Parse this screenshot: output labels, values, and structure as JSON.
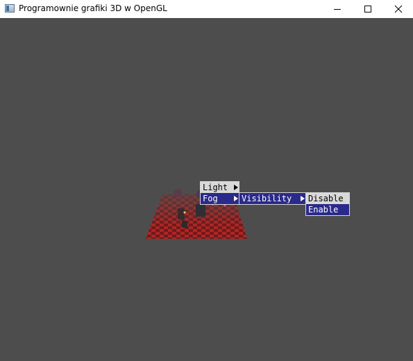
{
  "window": {
    "title": "Programownie grafiki 3D w OpenGL",
    "background_color": "#4d4d4d",
    "icons": {
      "app": "app-window-icon",
      "minimize": "minimize-icon",
      "maximize": "maximize-icon",
      "close": "close-icon"
    }
  },
  "context_menu": {
    "items": [
      {
        "label": "Light",
        "has_submenu": true,
        "highlighted": true
      },
      {
        "label": "Fog",
        "has_submenu": true,
        "highlighted": false
      }
    ],
    "fog_submenu": {
      "items": [
        {
          "label": "Visibility",
          "has_submenu": true,
          "highlighted": false
        }
      ]
    },
    "visibility_submenu": {
      "items": [
        {
          "label": "Disable",
          "highlighted": true
        },
        {
          "label": "Enable",
          "highlighted": false
        }
      ]
    },
    "colors": {
      "menu_bg": "#2a2a8a",
      "highlight_bg": "#d9d9d9",
      "text": "#ffffff"
    }
  }
}
